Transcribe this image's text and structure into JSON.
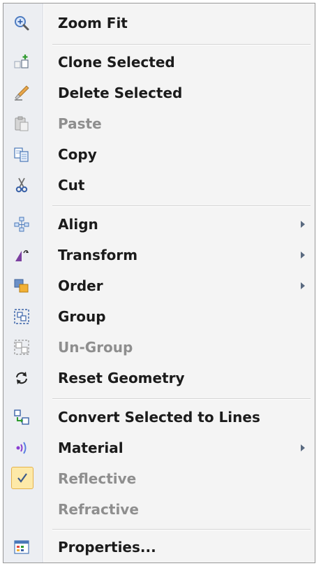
{
  "menu": {
    "items": [
      {
        "label": "Zoom Fit",
        "icon": "zoom-fit-icon",
        "enabled": true
      },
      {
        "label": "Clone Selected",
        "icon": "clone-icon",
        "enabled": true
      },
      {
        "label": "Delete Selected",
        "icon": "delete-icon",
        "enabled": true
      },
      {
        "label": "Paste",
        "icon": "paste-icon",
        "enabled": false
      },
      {
        "label": "Copy",
        "icon": "copy-icon",
        "enabled": true
      },
      {
        "label": "Cut",
        "icon": "scissors-icon",
        "enabled": true
      },
      {
        "label": "Align",
        "icon": "align-icon",
        "enabled": true,
        "submenu": true
      },
      {
        "label": "Transform",
        "icon": "transform-icon",
        "enabled": true,
        "submenu": true
      },
      {
        "label": "Order",
        "icon": "order-icon",
        "enabled": true,
        "submenu": true
      },
      {
        "label": "Group",
        "icon": "group-icon",
        "enabled": true
      },
      {
        "label": "Un-Group",
        "icon": "ungroup-icon",
        "enabled": false
      },
      {
        "label": "Reset Geometry",
        "icon": "reset-icon",
        "enabled": true
      },
      {
        "label": "Convert Selected to Lines",
        "icon": "convert-lines-icon",
        "enabled": true
      },
      {
        "label": "Material",
        "icon": "material-icon",
        "enabled": true,
        "submenu": true
      },
      {
        "label": "Reflective",
        "icon": "checkmark-icon",
        "enabled": false,
        "checked": true
      },
      {
        "label": "Refractive",
        "icon": "",
        "enabled": false,
        "checked": false
      },
      {
        "label": "Properties...",
        "icon": "properties-icon",
        "enabled": true
      }
    ]
  },
  "colors": {
    "menu_background": "#f4f4f4",
    "gutter_background": "#eceef2",
    "enabled_text": "#1b1b1b",
    "disabled_text": "#8e8e8e",
    "check_highlight": "#fde9a8"
  }
}
